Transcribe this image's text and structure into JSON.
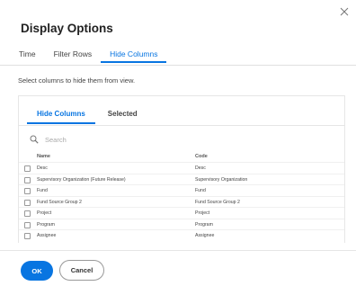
{
  "dialog": {
    "title": "Display Options",
    "close_icon": "close-icon"
  },
  "tabs": [
    {
      "label": "Time",
      "active": false
    },
    {
      "label": "Filter Rows",
      "active": false
    },
    {
      "label": "Hide Columns",
      "active": true
    }
  ],
  "instructions": "Select columns to hide them from view.",
  "inner_tabs": [
    {
      "label": "Hide Columns",
      "active": true
    },
    {
      "label": "Selected",
      "active": false
    }
  ],
  "search": {
    "icon": "search-icon",
    "placeholder": "Search",
    "value": ""
  },
  "table": {
    "headers": {
      "name": "Name",
      "code": "Code"
    },
    "rows": [
      {
        "name": "Desc",
        "code": "Desc",
        "checked": false
      },
      {
        "name": "Supervisory Organization (Future Release)",
        "code": "Supervisory Organization",
        "checked": false
      },
      {
        "name": "Fund",
        "code": "Fund",
        "checked": false
      },
      {
        "name": "Fund Source Group 2",
        "code": "Fund Source Group 2",
        "checked": false
      },
      {
        "name": "Project",
        "code": "Project",
        "checked": false
      },
      {
        "name": "Program",
        "code": "Program",
        "checked": false
      },
      {
        "name": "Assignee",
        "code": "Assignee",
        "checked": false
      }
    ]
  },
  "footer": {
    "ok_label": "OK",
    "cancel_label": "Cancel"
  },
  "colors": {
    "accent": "#0875e1"
  }
}
